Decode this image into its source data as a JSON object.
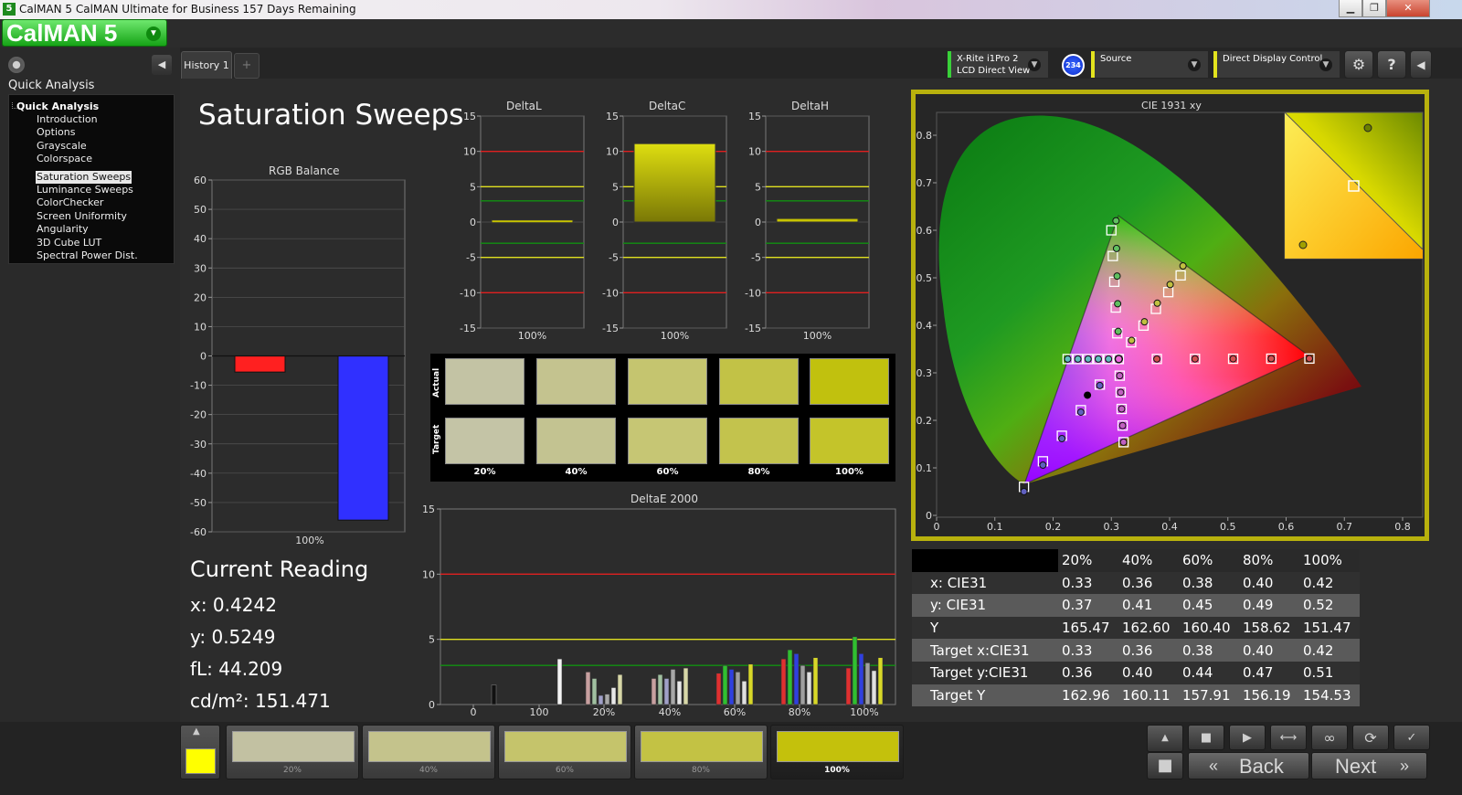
{
  "window": {
    "title": "CalMAN 5 CalMAN Ultimate for Business 157 Days Remaining",
    "app_icon_label": "5",
    "buttons": {
      "minimize": "▁",
      "restore": "❐",
      "close": "✕"
    }
  },
  "logo": {
    "text": "CalMAN 5",
    "menu_glyph": "▼"
  },
  "sidebar": {
    "heading": "Quick Analysis",
    "collapse_glyph": "◀",
    "group": "Quick Analysis",
    "items": [
      {
        "label": "Introduction",
        "selected": false
      },
      {
        "label": "Options",
        "selected": false
      },
      {
        "label": "Grayscale",
        "selected": false
      },
      {
        "label": "Colorspace",
        "selected": false
      },
      {
        "label": "Saturation Sweeps",
        "selected": true
      },
      {
        "label": "Luminance Sweeps",
        "selected": false
      },
      {
        "label": "ColorChecker",
        "selected": false
      },
      {
        "label": "Screen Uniformity",
        "selected": false
      },
      {
        "label": "Angularity",
        "selected": false
      },
      {
        "label": "3D Cube LUT",
        "selected": false
      },
      {
        "label": "Spectral Power Dist.",
        "selected": false
      }
    ]
  },
  "tabs": {
    "active": "History 1",
    "add_glyph": "+"
  },
  "devices": {
    "meter": {
      "line1": "X-Rite i1Pro 2",
      "line2": "LCD Direct View",
      "color": "#39d139"
    },
    "meter_badge": "234",
    "source": {
      "label": "Source",
      "color": "#e3e31e"
    },
    "display": {
      "label": "Direct Display Control",
      "color": "#e3e31e"
    },
    "settings_icon": "⚙",
    "help_icon": "?",
    "back_icon": "◀",
    "chevron": "▼"
  },
  "page": {
    "title": "Saturation Sweeps"
  },
  "charts": {
    "rgb_balance": {
      "type": "bar",
      "title": "RGB Balance",
      "categories": [
        "100%"
      ],
      "series": [
        {
          "color": "red",
          "values": [
            -5.5
          ]
        },
        {
          "color": "green",
          "values": [
            0
          ]
        },
        {
          "color": "blue",
          "values": [
            -56
          ]
        }
      ],
      "ylim": [
        -60,
        60
      ],
      "yticks": [
        60,
        50,
        40,
        30,
        20,
        10,
        0,
        -10,
        -20,
        -30,
        -40,
        -50,
        -60
      ]
    },
    "delta_l": {
      "type": "bar",
      "title": "DeltaL",
      "categories": [
        "100%"
      ],
      "values": [
        0.1
      ],
      "ylim": [
        -15,
        15
      ],
      "yticks": [
        15,
        10,
        5,
        0,
        -5,
        -10,
        -15
      ]
    },
    "delta_c": {
      "type": "bar",
      "title": "DeltaC",
      "categories": [
        "100%"
      ],
      "values": [
        11.1
      ],
      "ylim": [
        -15,
        15
      ],
      "yticks": [
        15,
        10,
        5,
        0,
        -5,
        -10,
        -15
      ]
    },
    "delta_h": {
      "type": "bar",
      "title": "DeltaH",
      "categories": [
        "100%"
      ],
      "values": [
        0.5
      ],
      "ylim": [
        -15,
        15
      ],
      "yticks": [
        15,
        10,
        5,
        0,
        -5,
        -10,
        -15
      ]
    },
    "delta_e": {
      "type": "bar",
      "title": "DeltaE 2000",
      "x_ticks": [
        "0",
        "100",
        "20%",
        "40%",
        "60%",
        "80%",
        "100%"
      ],
      "ylim": [
        0,
        15
      ],
      "yticks": [
        15,
        10,
        5,
        0
      ],
      "groups": [
        {
          "label": "0",
          "values": [
            1.5
          ]
        },
        {
          "label": "100",
          "values": [
            3.5
          ]
        },
        {
          "label": "20%",
          "values": [
            2.5,
            2.0,
            0.7,
            0.8,
            1.3,
            2.3
          ]
        },
        {
          "label": "40%",
          "values": [
            2.0,
            2.3,
            2.0,
            2.7,
            1.8,
            2.8
          ]
        },
        {
          "label": "60%",
          "values": [
            2.4,
            3.0,
            2.7,
            2.5,
            1.8,
            3.1
          ]
        },
        {
          "label": "80%",
          "values": [
            3.5,
            4.2,
            3.9,
            3.0,
            2.5,
            3.6
          ]
        },
        {
          "label": "100%",
          "values": [
            2.8,
            5.2,
            3.9,
            3.2,
            2.6,
            3.6
          ]
        }
      ]
    }
  },
  "swatches": {
    "row_actual": "Actual",
    "row_target": "Target",
    "labels": [
      "20%",
      "40%",
      "60%",
      "80%",
      "100%"
    ],
    "actual_colors": [
      "#c3c3a4",
      "#c4c38f",
      "#c5c56f",
      "#c2c246",
      "#c1c10e"
    ],
    "target_colors": [
      "#c4c4a6",
      "#c3c391",
      "#c6c674",
      "#c3c34d",
      "#c4c42a"
    ]
  },
  "current_reading": {
    "heading": "Current Reading",
    "x": "x: 0.4242",
    "y": "y: 0.5249",
    "fl": "fL: 44.209",
    "cdm2": "cd/m²: 151.471"
  },
  "cie": {
    "title": "CIE 1931 xy",
    "xticks": [
      "0",
      "0.1",
      "0.2",
      "0.3",
      "0.4",
      "0.5",
      "0.6",
      "0.7",
      "0.8"
    ],
    "yticks": [
      "0.8",
      "0.7",
      "0.6",
      "0.5",
      "0.4",
      "0.3",
      "0.2",
      "0.1",
      "0"
    ]
  },
  "table": {
    "header": [
      "",
      "20%",
      "40%",
      "60%",
      "80%",
      "100%"
    ],
    "rows": [
      [
        "x: CIE31",
        "0.33",
        "0.36",
        "0.38",
        "0.40",
        "0.42"
      ],
      [
        "y: CIE31",
        "0.37",
        "0.41",
        "0.45",
        "0.49",
        "0.52"
      ],
      [
        "Y",
        "165.47",
        "162.60",
        "160.40",
        "158.62",
        "151.47"
      ],
      [
        "Target x:CIE31",
        "0.33",
        "0.36",
        "0.38",
        "0.40",
        "0.42"
      ],
      [
        "Target y:CIE31",
        "0.36",
        "0.40",
        "0.44",
        "0.47",
        "0.51"
      ],
      [
        "Target Y",
        "162.96",
        "160.11",
        "157.91",
        "156.19",
        "154.53"
      ]
    ]
  },
  "bottom": {
    "current_color": "#ffff00",
    "up_glyph": "▲",
    "patches": [
      {
        "label": "20%",
        "color": "#c2c1a2"
      },
      {
        "label": "40%",
        "color": "#c4c38c"
      },
      {
        "label": "60%",
        "color": "#c5c46b"
      },
      {
        "label": "80%",
        "color": "#c3c244"
      },
      {
        "label": "100%",
        "color": "#c4c10c"
      }
    ],
    "controls": {
      "stop": "■",
      "play": "▶",
      "sync": "⟷",
      "loop": "∞",
      "refresh": "⟳",
      "check": "✓",
      "read": "■"
    },
    "back_label": "Back",
    "next_label": "Next",
    "back_glyph": "«",
    "next_glyph": "»"
  }
}
